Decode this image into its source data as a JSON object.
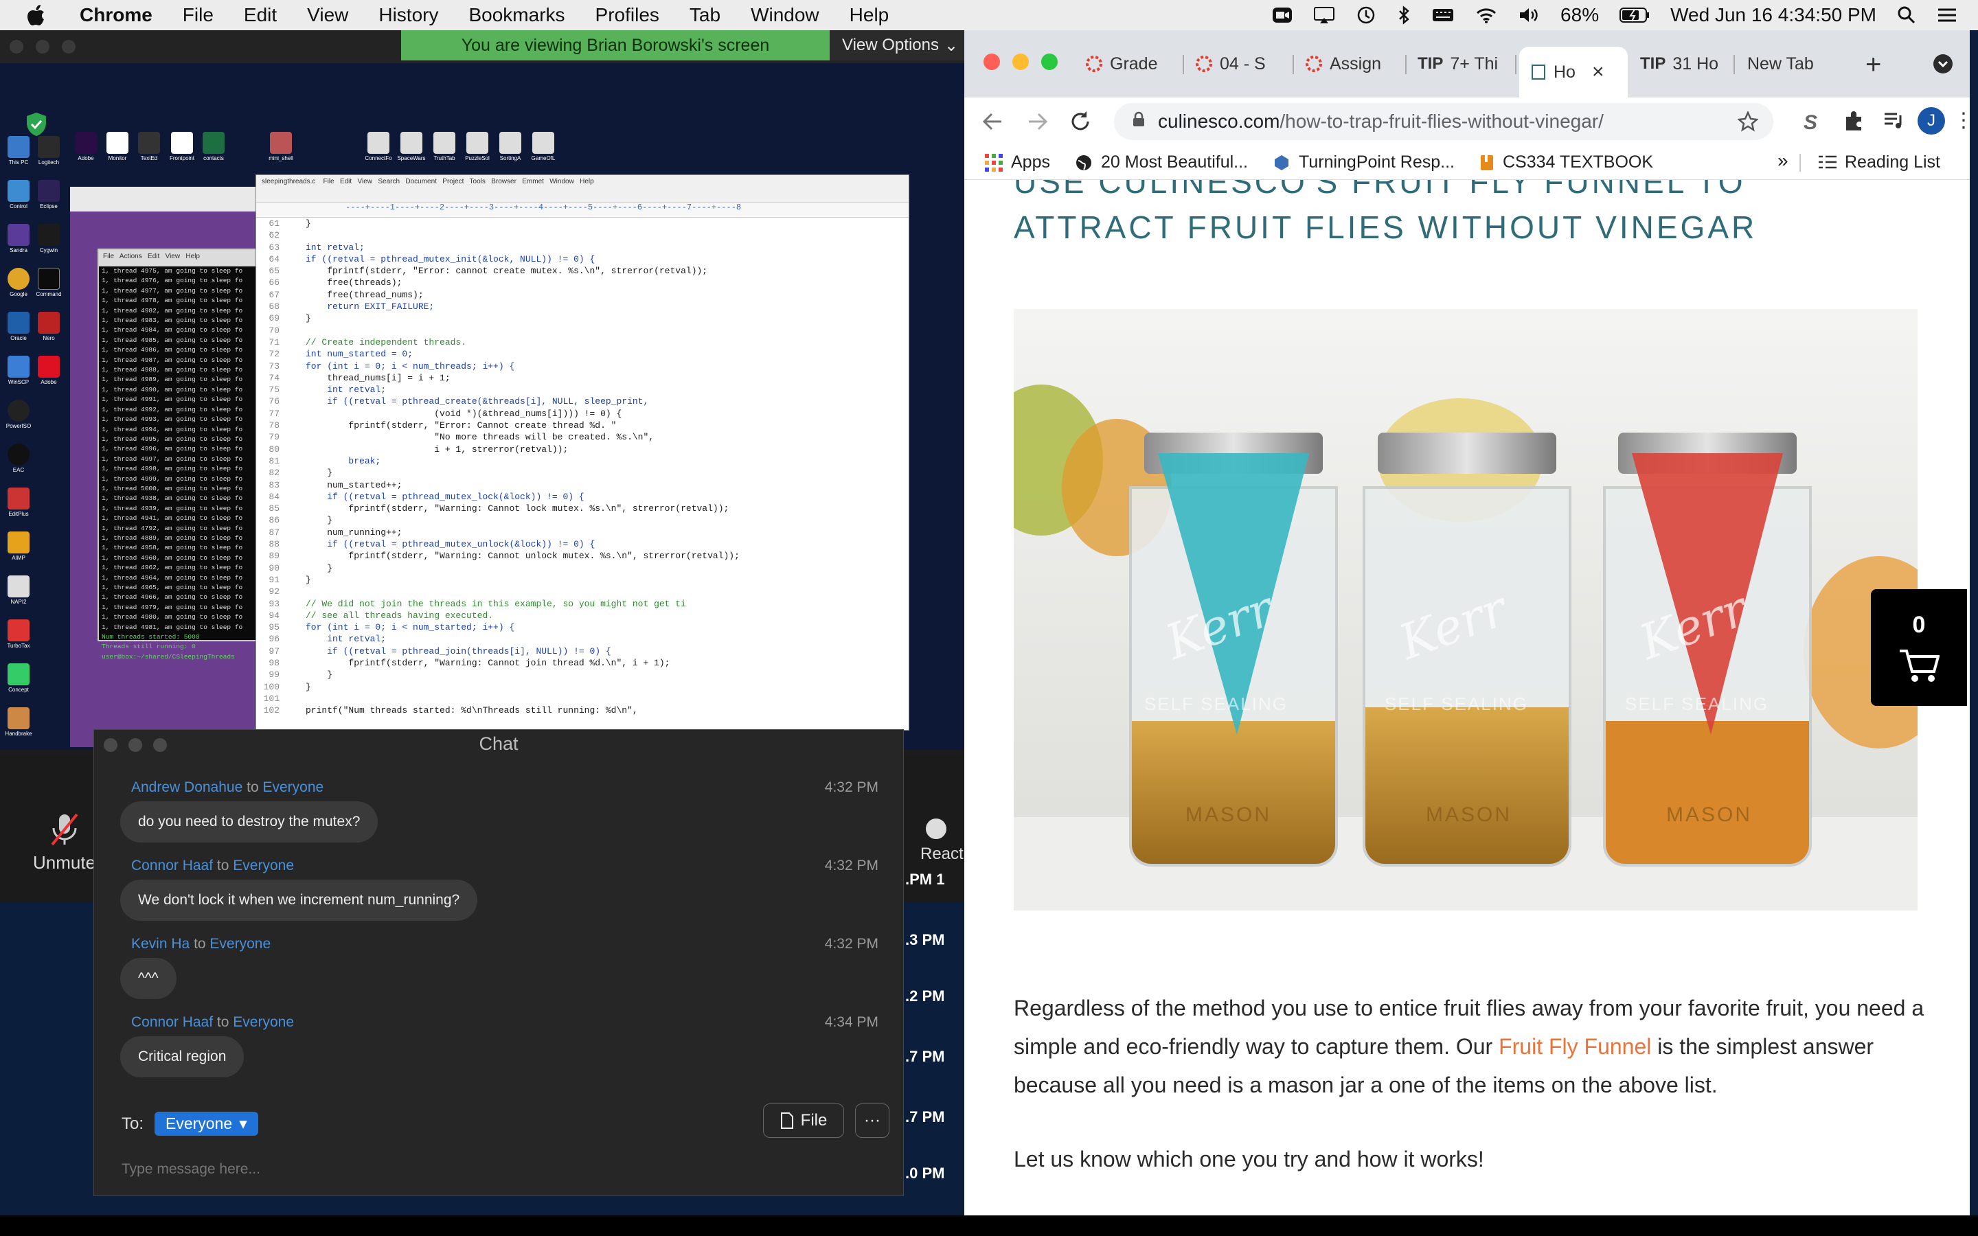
{
  "menubar": {
    "app": "Chrome",
    "items": [
      "File",
      "Edit",
      "View",
      "History",
      "Bookmarks",
      "Profiles",
      "Tab",
      "Window",
      "Help"
    ],
    "battery": "68%",
    "clock": "Wed Jun 16  4:34:50 PM"
  },
  "zoom": {
    "banner": "You are viewing Brian Borowski's screen",
    "view_options": "View Options",
    "unmute_label": "Unmute",
    "react_label": "React",
    "gallery_times": [
      ".PM 1",
      ".3 PM",
      ".2 PM",
      ".7 PM",
      ".7 PM",
      ".0 PM"
    ]
  },
  "remote": {
    "terminal_lines": [
      "1, thread 4975, am going to sleep fo",
      "1, thread 4976, am going to sleep fo",
      "1, thread 4977, am going to sleep fo",
      "1, thread 4978, am going to sleep fo",
      "1, thread 4982, am going to sleep fo",
      "1, thread 4983, am going to sleep fo",
      "1, thread 4984, am going to sleep fo",
      "1, thread 4985, am going to sleep fo",
      "1, thread 4986, am going to sleep fo",
      "1, thread 4987, am going to sleep fo",
      "1, thread 4988, am going to sleep fo",
      "1, thread 4989, am going to sleep fo",
      "1, thread 4990, am going to sleep fo",
      "1, thread 4991, am going to sleep fo",
      "1, thread 4992, am going to sleep fo",
      "1, thread 4993, am going to sleep fo",
      "1, thread 4994, am going to sleep fo",
      "1, thread 4995, am going to sleep fo",
      "1, thread 4996, am going to sleep fo",
      "1, thread 4997, am going to sleep fo",
      "1, thread 4998, am going to sleep fo",
      "1, thread 4999, am going to sleep fo",
      "1, thread 5000, am going to sleep fo",
      "1, thread 4938, am going to sleep fo",
      "1, thread 4939, am going to sleep fo",
      "1, thread 4941, am going to sleep fo",
      "1, thread 4792, am going to sleep fo",
      "1, thread 4889, am going to sleep fo",
      "1, thread 4958, am going to sleep fo",
      "1, thread 4960, am going to sleep fo",
      "1, thread 4962, am going to sleep fo",
      "1, thread 4964, am going to sleep fo",
      "1, thread 4965, am going to sleep fo",
      "1, thread 4966, am going to sleep fo",
      "1, thread 4979, am going to sleep fo",
      "1, thread 4980, am going to sleep fo",
      "1, thread 4981, am going to sleep fo",
      "Num threads started: 5000",
      "Threads still running: 0",
      "user@box:~/shared/CSleepingThreads"
    ],
    "editor_lines": [
      {
        "n": "61",
        "t": "}"
      },
      {
        "n": "62",
        "t": ""
      },
      {
        "n": "63",
        "t": "int retval;"
      },
      {
        "n": "64",
        "t": "if ((retval = pthread_mutex_init(&lock, NULL)) != 0) {"
      },
      {
        "n": "65",
        "t": "    fprintf(stderr, \"Error: cannot create mutex. %s.\\n\", strerror(retval));"
      },
      {
        "n": "66",
        "t": "    free(threads);"
      },
      {
        "n": "67",
        "t": "    free(thread_nums);"
      },
      {
        "n": "68",
        "t": "    return EXIT_FAILURE;"
      },
      {
        "n": "69",
        "t": "}"
      },
      {
        "n": "70",
        "t": ""
      },
      {
        "n": "71",
        "t": "// Create independent threads."
      },
      {
        "n": "72",
        "t": "int num_started = 0;"
      },
      {
        "n": "73",
        "t": "for (int i = 0; i < num_threads; i++) {"
      },
      {
        "n": "74",
        "t": "    thread_nums[i] = i + 1;"
      },
      {
        "n": "75",
        "t": "    int retval;"
      },
      {
        "n": "76",
        "t": "    if ((retval = pthread_create(&threads[i], NULL, sleep_print,"
      },
      {
        "n": "77",
        "t": "                        (void *)(&thread_nums[i]))) != 0) {"
      },
      {
        "n": "78",
        "t": "        fprintf(stderr, \"Error: Cannot create thread %d. \""
      },
      {
        "n": "79",
        "t": "                        \"No more threads will be created. %s.\\n\","
      },
      {
        "n": "80",
        "t": "                        i + 1, strerror(retval));"
      },
      {
        "n": "81",
        "t": "        break;"
      },
      {
        "n": "82",
        "t": "    }"
      },
      {
        "n": "83",
        "t": "    num_started++;"
      },
      {
        "n": "84",
        "t": "    if ((retval = pthread_mutex_lock(&lock)) != 0) {"
      },
      {
        "n": "85",
        "t": "        fprintf(stderr, \"Warning: Cannot lock mutex. %s.\\n\", strerror(retval));"
      },
      {
        "n": "86",
        "t": "    }"
      },
      {
        "n": "87",
        "t": "    num_running++;"
      },
      {
        "n": "88",
        "t": "    if ((retval = pthread_mutex_unlock(&lock)) != 0) {"
      },
      {
        "n": "89",
        "t": "        fprintf(stderr, \"Warning: Cannot unlock mutex. %s.\\n\", strerror(retval));"
      },
      {
        "n": "90",
        "t": "    }"
      },
      {
        "n": "91",
        "t": "}"
      },
      {
        "n": "92",
        "t": ""
      },
      {
        "n": "93",
        "t": "// We did not join the threads in this example, so you might not get ti"
      },
      {
        "n": "94",
        "t": "// see all threads having executed."
      },
      {
        "n": "95",
        "t": "for (int i = 0; i < num_started; i++) {"
      },
      {
        "n": "96",
        "t": "    int retval;"
      },
      {
        "n": "97",
        "t": "    if ((retval = pthread_join(threads[i], NULL)) != 0) {"
      },
      {
        "n": "98",
        "t": "        fprintf(stderr, \"Warning: Cannot join thread %d.\\n\", i + 1);"
      },
      {
        "n": "99",
        "t": "    }"
      },
      {
        "n": "100",
        "t": "}"
      },
      {
        "n": "101",
        "t": ""
      },
      {
        "n": "102",
        "t": "printf(\"Num threads started: %d\\nThreads still running: %d\\n\","
      }
    ]
  },
  "chat": {
    "title": "Chat",
    "messages": [
      {
        "from": "Andrew Donahue",
        "to": "Everyone",
        "time": "4:32 PM",
        "text": "do you need to destroy the mutex?"
      },
      {
        "from": "Connor Haaf",
        "to": "Everyone",
        "time": "4:32 PM",
        "text": "We don't lock it when we increment num_running?"
      },
      {
        "from": "Kevin Ha",
        "to": "Everyone",
        "time": "4:32 PM",
        "text": "^^^"
      },
      {
        "from": "Connor Haaf",
        "to": "Everyone",
        "time": "4:34 PM",
        "text": "Critical region"
      }
    ],
    "to_label": "To:",
    "recipient": "Everyone",
    "file_label": "File",
    "more_label": "···",
    "placeholder": "Type message here..."
  },
  "chrome": {
    "tabs": [
      {
        "label": "Grade",
        "icon": "canvas-icon"
      },
      {
        "label": "04 - S",
        "icon": "canvas-icon"
      },
      {
        "label": "Assign",
        "icon": "canvas-icon"
      },
      {
        "label": "7+ Thi",
        "icon": "tip-icon"
      },
      {
        "label": "Ho",
        "icon": "page-icon",
        "active": true
      },
      {
        "label": "31 Ho",
        "icon": "tip-icon"
      },
      {
        "label": "New Tab",
        "icon": ""
      }
    ],
    "url_domain": "culinesco.com",
    "url_path": "/how-to-trap-fruit-flies-without-vinegar/",
    "profile_initial": "J",
    "bookmarks": [
      "Apps",
      "20 Most Beautiful...",
      "TurningPoint Resp...",
      "CS334 TEXTBOOK"
    ],
    "reading_list": "Reading List"
  },
  "page": {
    "heading": "Use Culinesco's Fruit Fly Funnel to Attract Fruit Flies Without Vinegar",
    "jar_label": "Kerr",
    "jar_sub": "SELF SEALING",
    "jar_bottom": "MASON",
    "para1_before": "Regardless of the method you use to entice fruit flies away from your favorite fruit, you need a simple and eco-friendly way to capture them.  Our ",
    "para1_link": "Fruit Fly Funnel",
    "para1_after": " is the simplest answer because all you need is a mason jar a one of the items on the above list.",
    "para2": "Let us know which one you try and how it works!",
    "cart_count": "0"
  }
}
